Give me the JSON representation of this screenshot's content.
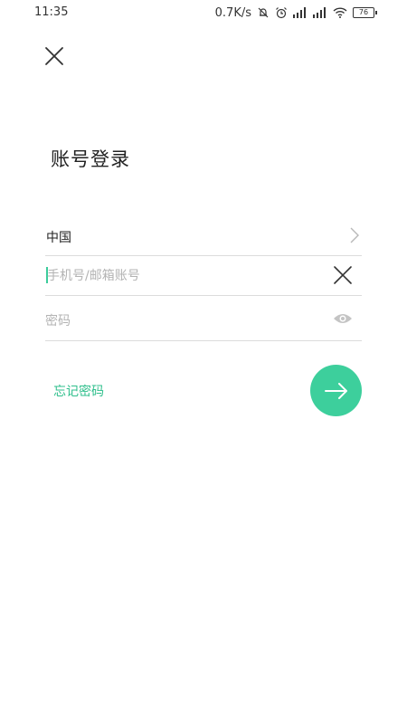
{
  "status_bar": {
    "time": "11:35",
    "net_speed": "0.7K/s",
    "battery_level": "76",
    "icons": [
      "mute-bell-icon",
      "alarm-icon",
      "signal-icon",
      "signal-icon",
      "wifi-icon",
      "battery-icon"
    ]
  },
  "header": {
    "close_icon": "close-icon",
    "title": "账号登录"
  },
  "form": {
    "region": {
      "value": "中国",
      "icon": "chevron-right-icon"
    },
    "phone": {
      "value": "",
      "placeholder": "手机号/邮箱账号",
      "clear_icon": "clear-icon"
    },
    "password": {
      "value": "",
      "placeholder": "密码",
      "toggle_icon": "eye-icon"
    },
    "forgot_label": "忘记密码",
    "submit_icon": "arrow-right-icon"
  },
  "colors": {
    "accent": "#3dcf9c",
    "link": "#2fbf8c",
    "divider": "#dcdcdc",
    "placeholder": "#b3b3b3"
  }
}
